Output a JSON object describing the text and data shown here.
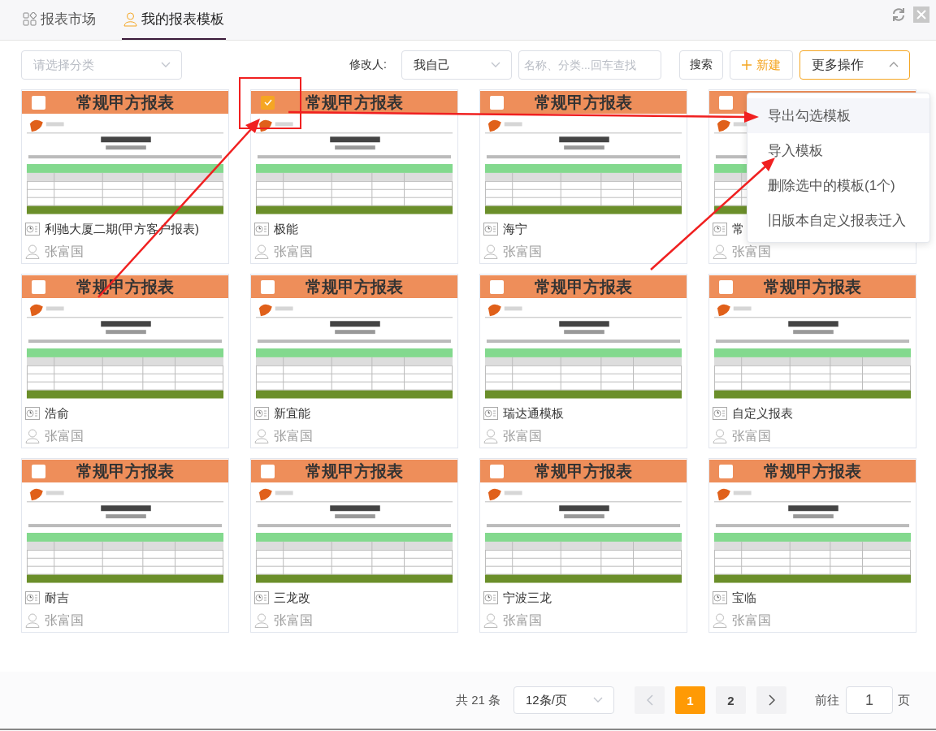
{
  "tabs": [
    {
      "label": "报表市场",
      "kind": "market",
      "selected": false
    },
    {
      "label": "我的报表模板",
      "kind": "mine",
      "selected": true
    }
  ],
  "toolbar": {
    "category": {
      "placeholder": "请选择分类"
    },
    "modifier_label": "修改人:",
    "modifier": {
      "value": "我自己"
    },
    "search": {
      "placeholder": "名称、分类...回车查找"
    },
    "search_button": "搜索",
    "new_button": "新建",
    "more_button": {
      "label": "更多操作",
      "expanded": true
    }
  },
  "cards": [
    {
      "title": "常规甲方报表",
      "checked": false,
      "name": "利驰大厦二期(甲方客户报表)",
      "user": "张富国"
    },
    {
      "title": "常规甲方报表",
      "checked": true,
      "name": "极能",
      "user": "张富国"
    },
    {
      "title": "常规甲方报表",
      "checked": false,
      "name": "海宁",
      "user": "张富国"
    },
    {
      "checked": false,
      "name": "常",
      "user": "张富国"
    },
    {
      "title": "常规甲方报表",
      "checked": false,
      "name": "浩俞",
      "user": "张富国"
    },
    {
      "title": "常规甲方报表",
      "checked": false,
      "name": "新宜能",
      "user": "张富国"
    },
    {
      "title": "常规甲方报表",
      "checked": false,
      "name": "瑞达通模板",
      "user": "张富国"
    },
    {
      "title": "常规甲方报表",
      "checked": false,
      "name": "自定义报表",
      "user": "张富国"
    },
    {
      "title": "常规甲方报表",
      "checked": false,
      "name": "耐吉",
      "user": "张富国"
    },
    {
      "title": "常规甲方报表",
      "checked": false,
      "name": "三龙改",
      "user": "张富国"
    },
    {
      "title": "常规甲方报表",
      "checked": false,
      "name": "宁波三龙",
      "user": "张富国"
    },
    {
      "title": "常规甲方报表",
      "checked": false,
      "name": "宝临",
      "user": "张富国"
    }
  ],
  "menu": [
    {
      "label": "导出勾选模板",
      "selected": true
    },
    {
      "label": "导入模板",
      "selected": false
    },
    {
      "label": "删除选中的模板(1个)",
      "selected": false
    },
    {
      "label": "旧版本自定义报表迁入",
      "selected": false
    }
  ],
  "pagination": {
    "total": "共 21 条",
    "page_size": "12条/页",
    "pages": [
      {
        "label": "1",
        "selected": true
      },
      {
        "label": "2",
        "selected": false
      }
    ],
    "prev_disabled": true,
    "goto_label": "前往",
    "goto_value": "1",
    "goto_suffix": "页"
  }
}
